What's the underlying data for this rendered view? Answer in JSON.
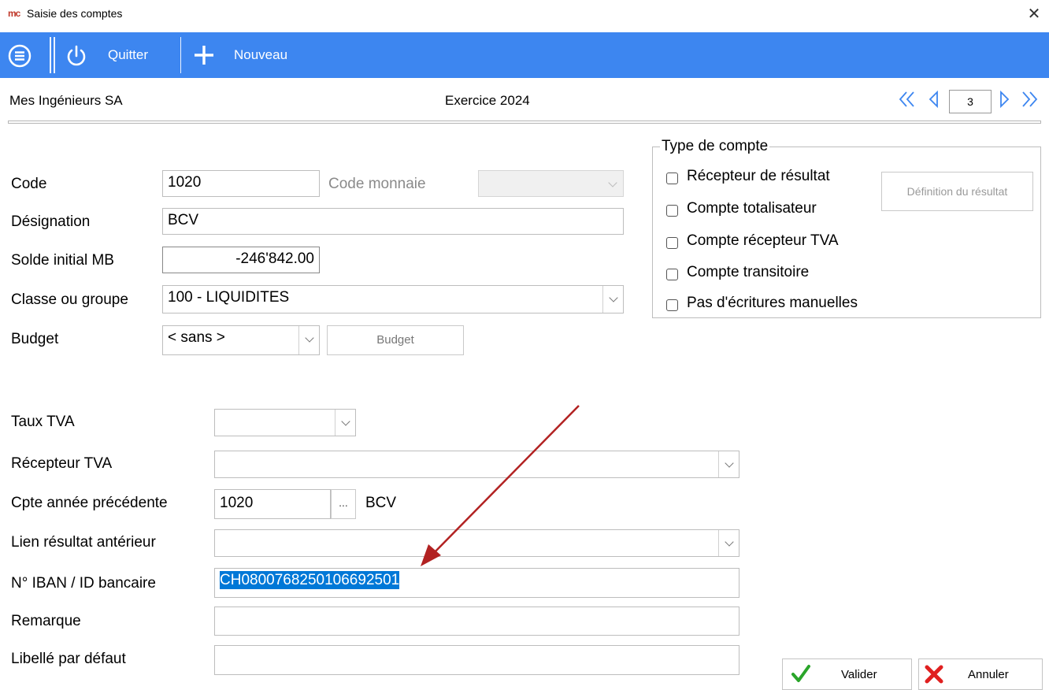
{
  "window": {
    "title": "Saisie des comptes",
    "logo": "mc",
    "close_glyph": "✕"
  },
  "toolbar": {
    "quit_label": "Quitter",
    "new_label": "Nouveau"
  },
  "header": {
    "company": "Mes Ingénieurs SA",
    "exercise": "Exercice 2024",
    "page_number": "3"
  },
  "form": {
    "code_label": "Code",
    "code_value": "1020",
    "currency_label": "Code monnaie",
    "currency_value": "",
    "designation_label": "Désignation",
    "designation_value": "BCV",
    "opening_balance_label": "Solde initial MB",
    "opening_balance_value": "-246'842.00",
    "class_label": "Classe ou groupe",
    "class_value": "100 - LIQUIDITES",
    "budget_label": "Budget",
    "budget_value": "< sans >",
    "budget_button": "Budget",
    "vat_rate_label": "Taux TVA",
    "vat_rate_value": "",
    "vat_receiver_label": "Récepteur TVA",
    "vat_receiver_value": "",
    "prev_year_label": "Cpte année précédente",
    "prev_year_value": "1020",
    "prev_year_browse": "...",
    "prev_year_name": "BCV",
    "prev_result_label": "Lien résultat antérieur",
    "prev_result_value": "",
    "iban_label": "N° IBAN / ID bancaire",
    "iban_value": "CH0800768250106692501",
    "remark_label": "Remarque",
    "remark_value": "",
    "default_text_label": "Libellé par défaut",
    "default_text_value": ""
  },
  "account_type": {
    "legend": "Type de compte",
    "options": [
      {
        "label": "Récepteur de résultat",
        "checked": false
      },
      {
        "label": "Compte totalisateur",
        "checked": false
      },
      {
        "label": "Compte récepteur TVA",
        "checked": false
      },
      {
        "label": "Compte transitoire",
        "checked": false
      },
      {
        "label": "Pas d'écritures manuelles",
        "checked": false
      }
    ],
    "result_button": "Définition du résultat"
  },
  "footer": {
    "validate_label": "Valider",
    "cancel_label": "Annuler"
  },
  "colors": {
    "toolbar": "#3d86f0",
    "selection": "#0078d7",
    "annotation_arrow": "#b22222"
  }
}
